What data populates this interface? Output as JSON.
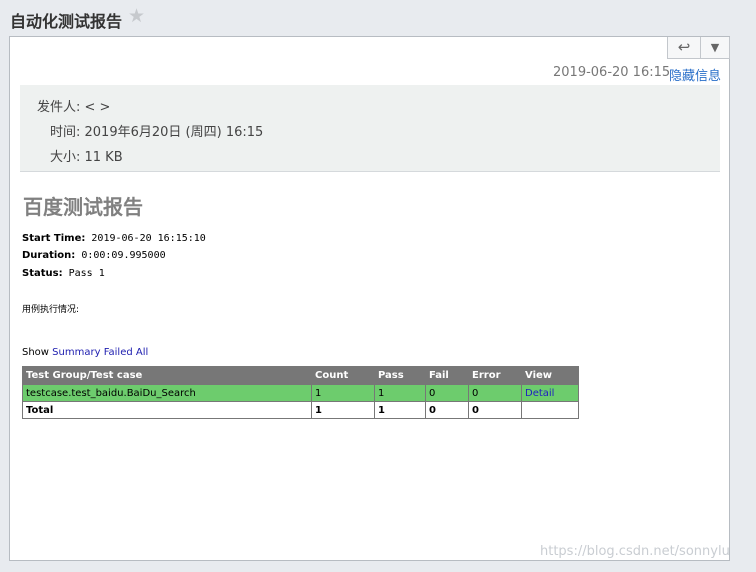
{
  "header": {
    "subject": "自动化测试报告",
    "star_icon": "star-icon"
  },
  "toolbar": {
    "reply_icon": "reply-icon",
    "more_icon": "chevron-down-icon"
  },
  "mail": {
    "date": "2019-06-20 16:15",
    "hide_info": "隐藏信息",
    "sender": "发件人: < >",
    "time": "时间: 2019年6月20日 (周四) 16:15",
    "size": "大小: 11 KB"
  },
  "report": {
    "title": "百度测试报告",
    "start_label": "Start Time:",
    "start_value": "2019-06-20 16:15:10",
    "duration_label": "Duration:",
    "duration_value": "0:00:09.995000",
    "status_label": "Status:",
    "status_value": "Pass 1",
    "usecase_text": "用例执行情况:",
    "show_label": "Show",
    "filter_summary": "Summary",
    "filter_failed": "Failed",
    "filter_all": "All",
    "columns": [
      "Test Group/Test case",
      "Count",
      "Pass",
      "Fail",
      "Error",
      "View"
    ],
    "rows": [
      {
        "name": "testcase.test_baidu.BaiDu_Search",
        "count": "1",
        "pass": "1",
        "fail": "0",
        "error": "0",
        "view": "Detail"
      }
    ],
    "total": {
      "name": "Total",
      "count": "1",
      "pass": "1",
      "fail": "0",
      "error": "0",
      "view": ""
    }
  },
  "watermark": "https://blog.csdn.net/sonnylu",
  "colors": {
    "pass_row": "#6dcc6d",
    "header_row": "#777777",
    "link": "#2a6fc9"
  }
}
